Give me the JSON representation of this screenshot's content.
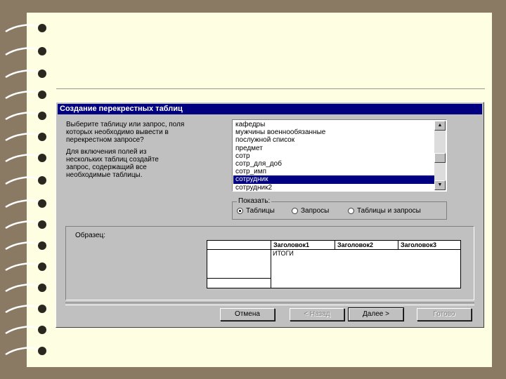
{
  "dialog": {
    "title": "Создание перекрестных таблиц",
    "instructions": [
      "Выберите таблицу или запрос, поля",
      "которых необходимо вывести в",
      "перекрестном запросе?",
      "",
      "Для включения полей из",
      "нескольких таблиц создайте",
      "запрос, содержащий все",
      "необходимые таблицы."
    ],
    "list_items": [
      "кафедры",
      "мужчины военнообязанные",
      "послужной список",
      "предмет",
      "сотр",
      "сотр_для_доб",
      "сотр_имп",
      "сотрудник",
      "сотрудник2"
    ],
    "selected_item": "сотрудник",
    "show_group": {
      "label": "Показать:",
      "options": [
        "Таблицы",
        "Запросы",
        "Таблицы и запросы"
      ],
      "selected": "Таблицы"
    },
    "sample": {
      "label": "Образец:",
      "headers": [
        "Заголовок1",
        "Заголовок2",
        "Заголовок3"
      ],
      "total_label": "ИТОГИ"
    },
    "buttons": {
      "cancel": "Отмена",
      "back": "< Назад",
      "next": "Далее >",
      "finish": "Готово"
    }
  },
  "colors": {
    "background": "#8a7a63",
    "paper": "#fefee2",
    "dialog": "#c0c0c0",
    "titlebar": "#000080"
  }
}
